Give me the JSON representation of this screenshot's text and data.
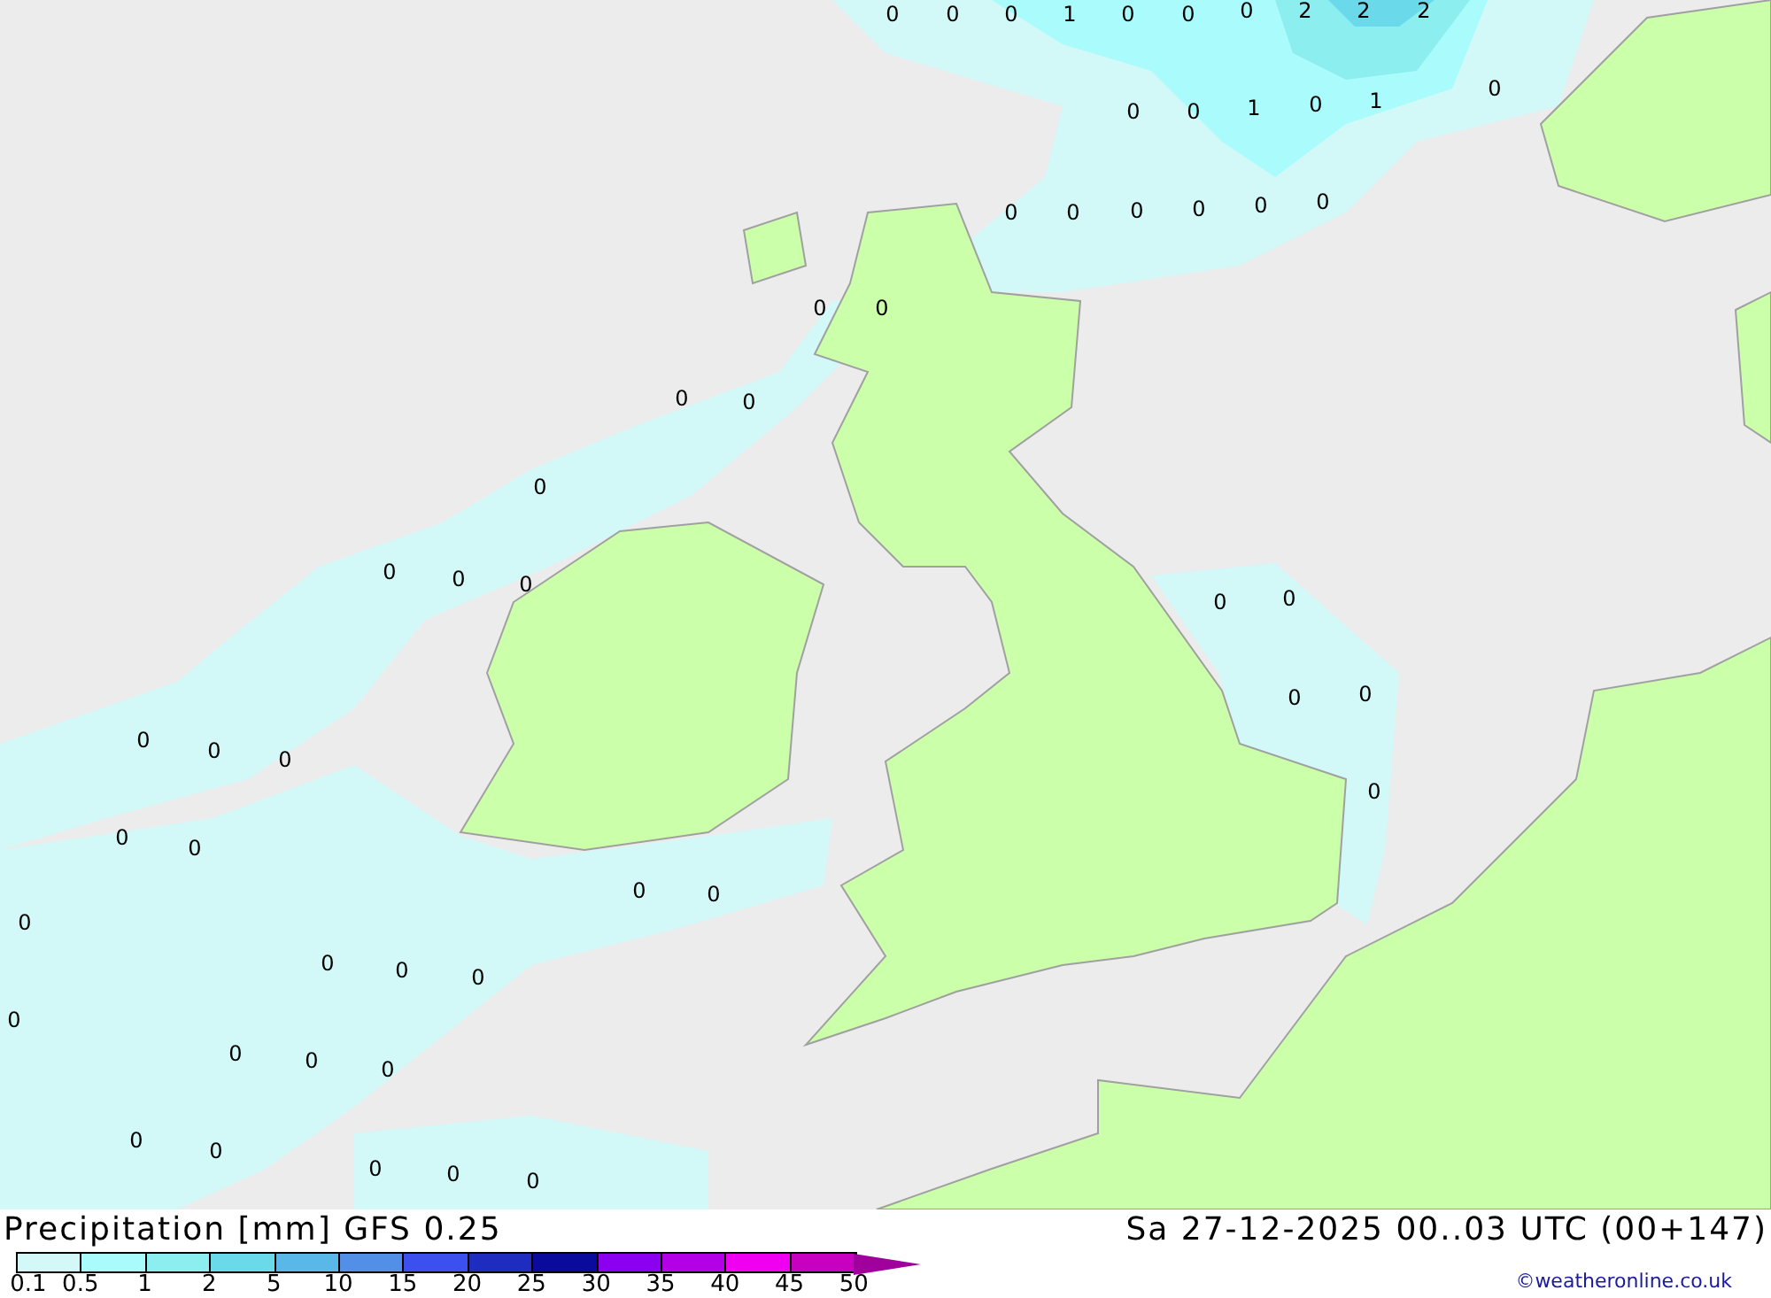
{
  "map_labels": [
    "0",
    "0",
    "0",
    "1",
    "0",
    "0",
    "0",
    "2",
    "2",
    "2",
    "0",
    "0",
    "1",
    "0",
    "1",
    "0",
    "0",
    "0",
    "0",
    "0",
    "0",
    "0",
    "0",
    "0",
    "0",
    "0",
    "0",
    "0",
    "0",
    "0",
    "0",
    "0",
    "0",
    "0",
    "0",
    "0",
    "0",
    "0",
    "0",
    "0",
    "0",
    "0",
    "0",
    "0",
    "0",
    "0",
    "0",
    "0",
    "0",
    "0",
    "0",
    "0",
    "0",
    "0",
    "0"
  ],
  "title": "Precipitation [mm] GFS 0.25",
  "datetime": "Sa 27-12-2025 00..03 UTC (00+147)",
  "legend": {
    "bins": [
      {
        "color": "#d4f7f7"
      },
      {
        "color": "#aafcfc"
      },
      {
        "color": "#8ceeee"
      },
      {
        "color": "#6adaea"
      },
      {
        "color": "#5ab8e8"
      },
      {
        "color": "#5290e8"
      },
      {
        "color": "#3c50f0"
      },
      {
        "color": "#1e2cc0"
      },
      {
        "color": "#0a0a9c"
      },
      {
        "color": "#8c00f0"
      },
      {
        "color": "#b400e6"
      },
      {
        "color": "#f000f0"
      },
      {
        "color": "#c800c0"
      }
    ],
    "labels": [
      "0.1",
      "0.5",
      "1",
      "2",
      "5",
      "10",
      "15",
      "20",
      "25",
      "30",
      "35",
      "40",
      "45",
      "50"
    ]
  },
  "credit": "©weatheronline.co.uk"
}
